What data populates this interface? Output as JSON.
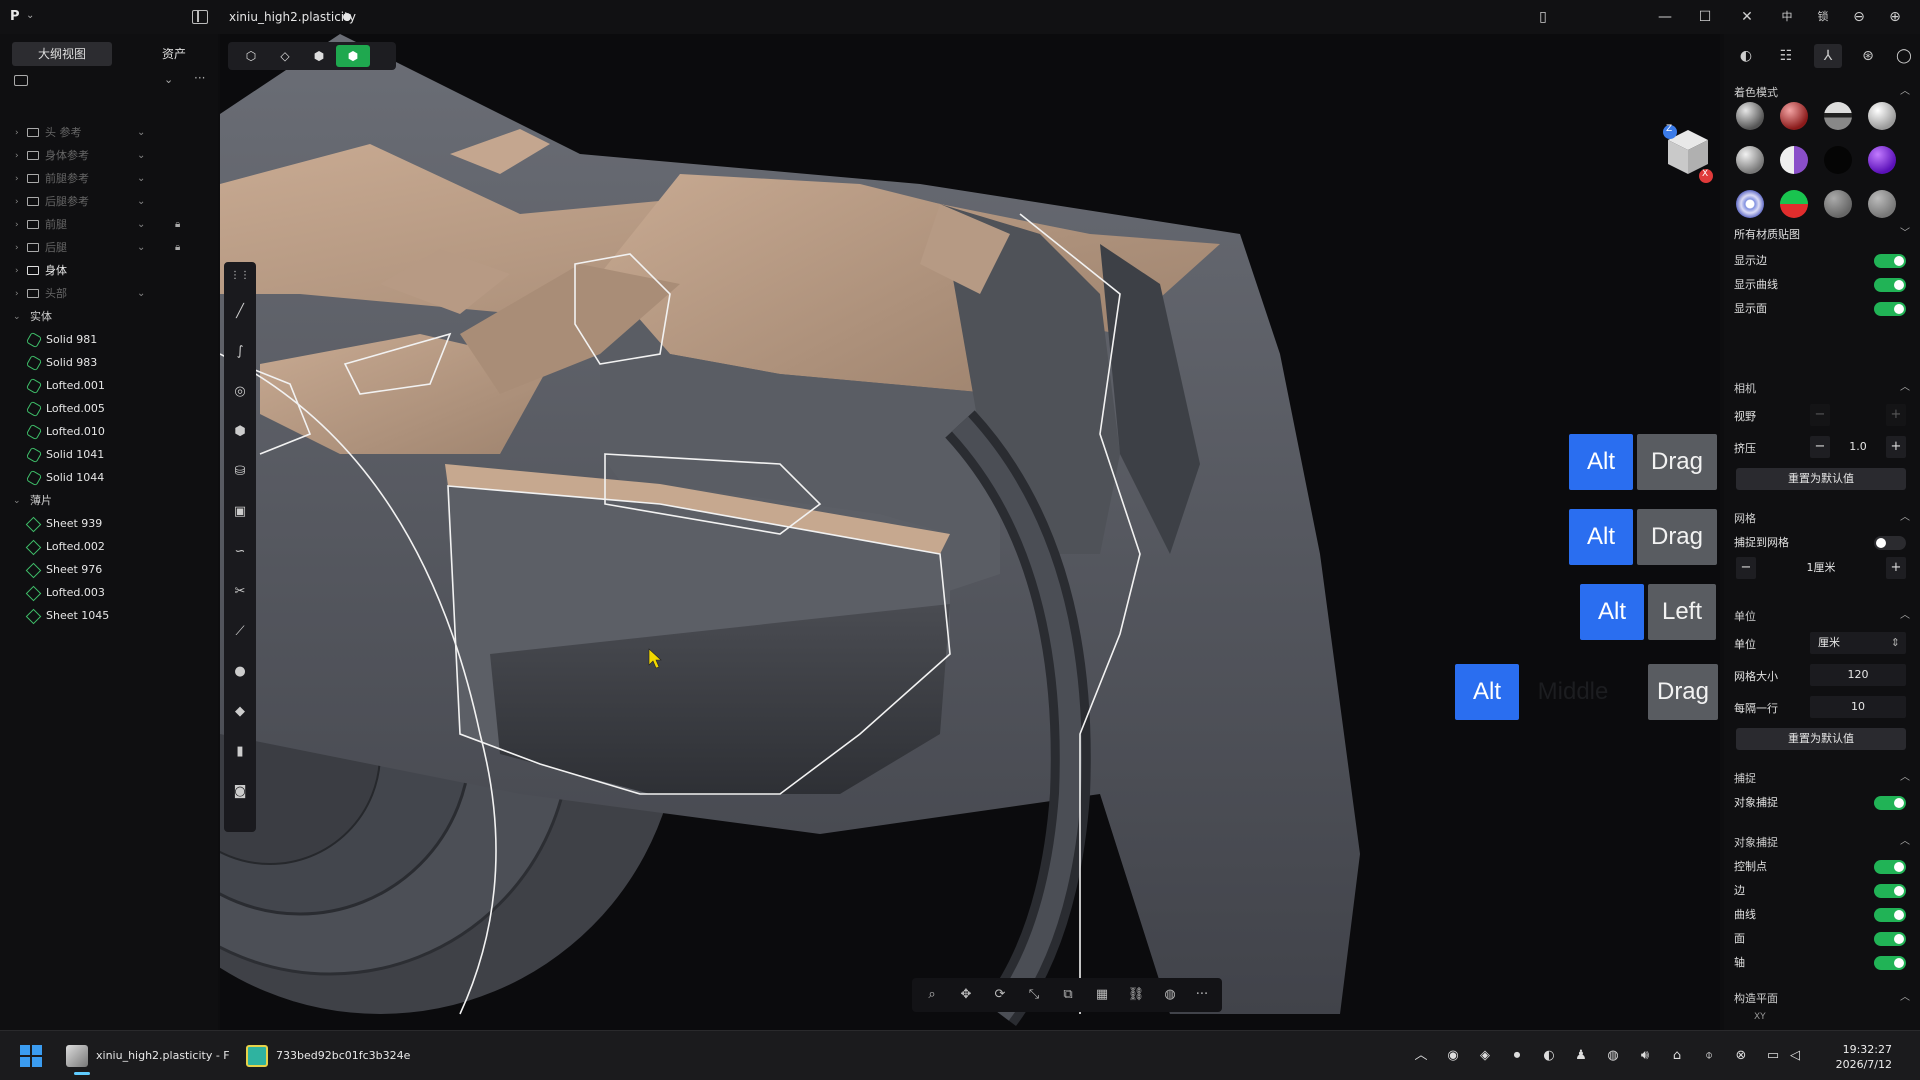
{
  "titlebar": {
    "app_logo": "P",
    "file_title": "xiniu_high2.plasticity",
    "icons": [
      "sidebar-toggle-icon",
      "panel-icon",
      "minimize-icon",
      "maximize-icon",
      "close-icon",
      "lang-icon",
      "input-icon",
      "zoom-out-icon",
      "zoom-in-icon"
    ],
    "extra_labels": [
      "中",
      "锁"
    ]
  },
  "sidebar": {
    "tabs": [
      {
        "label": "大纲视图",
        "active": true
      },
      {
        "label": "资产",
        "active": false
      }
    ],
    "groups": [
      {
        "label": "头 参考",
        "dim": true,
        "lock": false
      },
      {
        "label": "身体参考",
        "dim": true,
        "lock": false
      },
      {
        "label": "前腿参考",
        "dim": true,
        "lock": false
      },
      {
        "label": "后腿参考",
        "dim": true,
        "lock": false
      },
      {
        "label": "前腿",
        "dim": true,
        "lock": true
      },
      {
        "label": "后腿",
        "dim": true,
        "lock": true
      },
      {
        "label": "身体",
        "dim": false,
        "lock": false
      },
      {
        "label": "头部",
        "dim": true,
        "lock": false
      }
    ],
    "solids_header": "实体",
    "solids": [
      "Solid 981",
      "Solid 983",
      "Lofted.001",
      "Lofted.005",
      "Lofted.010",
      "Solid 1041",
      "Solid 1044"
    ],
    "sheets_header": "薄片",
    "sheets": [
      "Sheet 939",
      "Lofted.002",
      "Sheet 976",
      "Lofted.003",
      "Sheet 1045"
    ]
  },
  "viewport": {
    "keycaps": [
      {
        "row": 1,
        "keys": [
          "Alt",
          "Drag"
        ]
      },
      {
        "row": 2,
        "keys": [
          "Alt",
          "Drag"
        ]
      },
      {
        "row": 3,
        "keys": [
          "Alt",
          "Left"
        ]
      },
      {
        "row": 4,
        "keys": [
          "Alt",
          "Middle",
          "Drag"
        ]
      }
    ],
    "navcube_labels": [
      "Z",
      "X"
    ]
  },
  "rpanel": {
    "shading_title": "着色模式",
    "material_select": "所有材质贴图",
    "show_edges": "显示边",
    "show_curves": "显示曲线",
    "show_faces": "显示面",
    "camera_title": "相机",
    "fov_label": "视野",
    "squash_label": "挤压",
    "squash_value": "1.0",
    "reset_label": "重置为默认值",
    "grid_title": "网格",
    "snap_to_grid": "捕捉到网格",
    "grid_step_value": "1厘米",
    "units_title": "单位",
    "units_label": "单位",
    "units_value": "厘米",
    "grid_size_label": "网格大小",
    "grid_size_value": "120",
    "every_row_label": "每隔一行",
    "every_row_value": "10",
    "reset_label2": "重置为默认值",
    "snap_title": "捕捉",
    "object_snap": "对象捕捉",
    "object_snap_title": "对象捕捉",
    "snap_items": [
      "控制点",
      "边",
      "曲线",
      "面",
      "轴"
    ],
    "construction_plane": "构造平面",
    "construction_sub": "XY"
  },
  "taskbar": {
    "apps": [
      {
        "label": "xiniu_high2.plasticity - F",
        "active": true
      },
      {
        "label": "733bed92bc01fc3b324e",
        "active": false
      }
    ],
    "time": "19:32:27",
    "date": "2026/7/12"
  },
  "colors": {
    "accent_green": "#21b356",
    "keycap_blue": "#2a6ef0",
    "model_top": "#b89a83",
    "model_side": "#5d6068"
  }
}
